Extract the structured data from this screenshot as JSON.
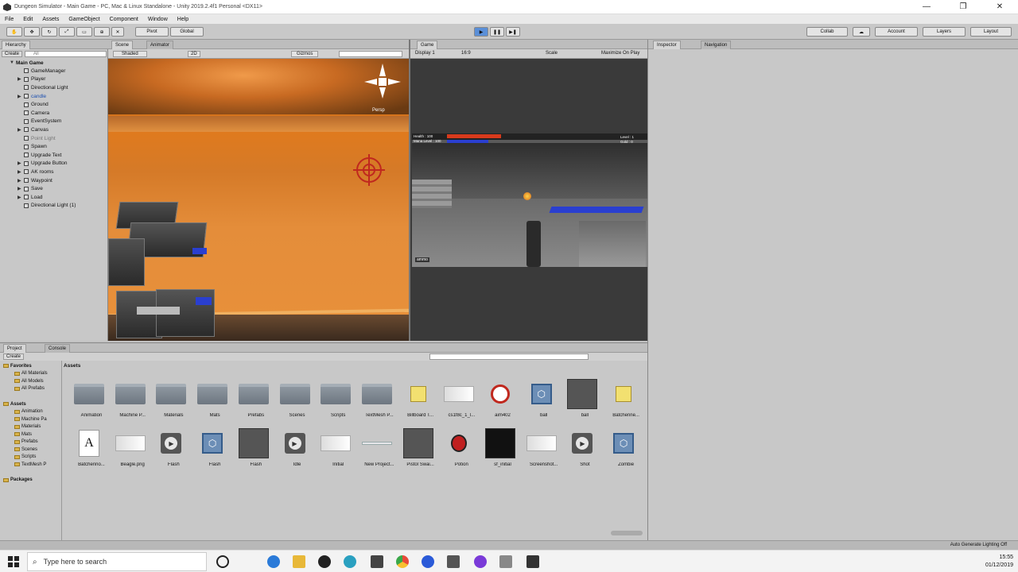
{
  "window": {
    "title": "Dungeon Simulator - Main Game - PC, Mac & Linux Standalone - Unity 2019.2.4f1 Personal <DX11>",
    "controls": [
      "—",
      "❐",
      "✕"
    ]
  },
  "menu": [
    "File",
    "Edit",
    "Assets",
    "GameObject",
    "Component",
    "Window",
    "Help"
  ],
  "toolbar": {
    "pivot_label": "Pivot",
    "global_label": "Global",
    "collab_label": "Collab",
    "account_label": "Account",
    "layers_label": "Layers",
    "layout_label": "Layout"
  },
  "hierarchy": {
    "tab": "Hierarchy",
    "create_label": "Create",
    "search_placeholder": "All",
    "scene_name": "Main Game",
    "items": [
      {
        "label": "GameManager",
        "expandable": false,
        "state": "normal"
      },
      {
        "label": "Player",
        "expandable": true,
        "state": "normal"
      },
      {
        "label": "Directional Light",
        "expandable": false,
        "state": "normal"
      },
      {
        "label": "candle",
        "expandable": true,
        "state": "selected"
      },
      {
        "label": "Ground",
        "expandable": false,
        "state": "normal"
      },
      {
        "label": "Camera",
        "expandable": false,
        "state": "normal"
      },
      {
        "label": "EventSystem",
        "expandable": false,
        "state": "normal"
      },
      {
        "label": "Canvas",
        "expandable": true,
        "state": "normal"
      },
      {
        "label": "Point Light",
        "expandable": false,
        "state": "dim"
      },
      {
        "label": "Spawn",
        "expandable": false,
        "state": "normal"
      },
      {
        "label": "Upgrade Text",
        "expandable": false,
        "state": "normal"
      },
      {
        "label": "Upgrade Button",
        "expandable": true,
        "state": "normal"
      },
      {
        "label": "AK rooms",
        "expandable": true,
        "state": "normal"
      },
      {
        "label": "Waypoint",
        "expandable": true,
        "state": "normal"
      },
      {
        "label": "Save",
        "expandable": true,
        "state": "normal"
      },
      {
        "label": "Load",
        "expandable": true,
        "state": "normal"
      },
      {
        "label": "Directional Light (1)",
        "expandable": false,
        "state": "normal"
      }
    ]
  },
  "scene": {
    "tab": "Scene",
    "tab2": "Animator",
    "shading": "Shaded",
    "mode": "2D",
    "gizmos": "Gizmos",
    "persp": "Persp"
  },
  "game": {
    "tab": "Game",
    "display": "Display 1",
    "aspect": "16:9",
    "scale_label": "Scale",
    "maximize": "Maximize On Play",
    "hud_left": "Health : 100",
    "hud_left2": "Mana Level : 100",
    "hud_right": "Level : 1",
    "hud_right2": "Gold : 0",
    "hud_bottom": "ammo"
  },
  "inspector": {
    "tab": "Inspector",
    "tab2": "Navigation"
  },
  "project": {
    "tab": "Project",
    "tab2": "Console",
    "create_label": "Create",
    "breadcrumb": "Assets",
    "tree": [
      {
        "label": "Favorites",
        "indent": 0,
        "bold": true
      },
      {
        "label": "All Materials",
        "indent": 1,
        "bold": false
      },
      {
        "label": "All Models",
        "indent": 1,
        "bold": false
      },
      {
        "label": "All Prefabs",
        "indent": 1,
        "bold": false
      },
      {
        "label": "Assets",
        "indent": 0,
        "bold": true
      },
      {
        "label": "Animation",
        "indent": 1,
        "bold": false
      },
      {
        "label": "Machine Pa",
        "indent": 1,
        "bold": false
      },
      {
        "label": "Materials",
        "indent": 1,
        "bold": false
      },
      {
        "label": "Mats",
        "indent": 1,
        "bold": false
      },
      {
        "label": "Prefabs",
        "indent": 1,
        "bold": false
      },
      {
        "label": "Scenes",
        "indent": 1,
        "bold": false
      },
      {
        "label": "Scripts",
        "indent": 1,
        "bold": false
      },
      {
        "label": "TextMesh P",
        "indent": 1,
        "bold": false
      },
      {
        "label": "Packages",
        "indent": 0,
        "bold": true
      }
    ],
    "assets_row1": [
      {
        "label": "Animation",
        "kind": "folder"
      },
      {
        "label": "Machine P...",
        "kind": "folder"
      },
      {
        "label": "Materials",
        "kind": "folder"
      },
      {
        "label": "Mats",
        "kind": "folder"
      },
      {
        "label": "Prefabs",
        "kind": "folder"
      },
      {
        "label": "Scenes",
        "kind": "folder"
      },
      {
        "label": "Scripts",
        "kind": "folder"
      },
      {
        "label": "TextMesh P...",
        "kind": "folder"
      },
      {
        "label": "Billboard T...",
        "kind": "sprite"
      },
      {
        "label": "cs1f8c_1_l...",
        "kind": "gun"
      },
      {
        "label": "aim402",
        "kind": "crosshair"
      },
      {
        "label": "ball",
        "kind": "prefab"
      },
      {
        "label": "ball",
        "kind": "dark"
      },
      {
        "label": "Batchenne...",
        "kind": "sprite"
      }
    ],
    "assets_row2": [
      {
        "label": "Batchenno...",
        "kind": "font"
      },
      {
        "label": "Beagle.png",
        "kind": "gun"
      },
      {
        "label": "Flash",
        "kind": "audio"
      },
      {
        "label": "Flash",
        "kind": "prefab"
      },
      {
        "label": "Flash",
        "kind": "dark"
      },
      {
        "label": "Idle",
        "kind": "audio"
      },
      {
        "label": "Initial",
        "kind": "gun"
      },
      {
        "label": "New Project...",
        "kind": "line"
      },
      {
        "label": "Pistol Swai...",
        "kind": "dark"
      },
      {
        "label": "Potion",
        "kind": "potion"
      },
      {
        "label": "sf_initial",
        "kind": "black"
      },
      {
        "label": "Screenshot...",
        "kind": "gun"
      },
      {
        "label": "Shot",
        "kind": "audio"
      },
      {
        "label": "Zombie",
        "kind": "prefab"
      }
    ]
  },
  "status": {
    "right": "Auto Generate Lighting Off"
  },
  "taskbar": {
    "search_placeholder": "Type here to search",
    "time": "15:55",
    "date": "01/12/2019"
  }
}
